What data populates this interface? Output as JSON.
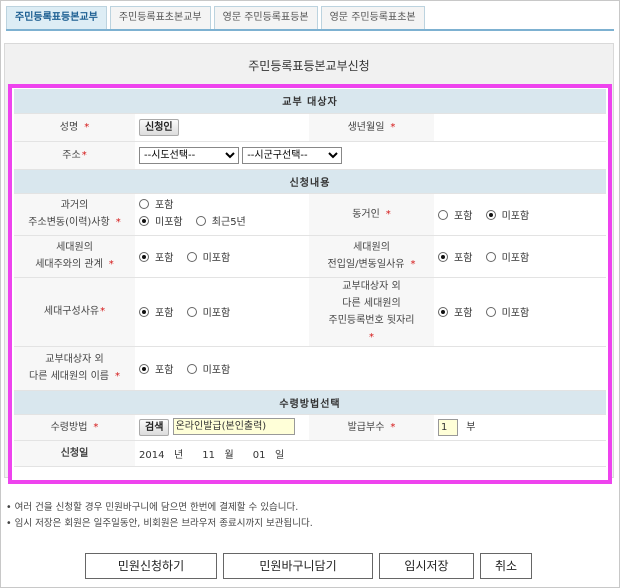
{
  "tabs": [
    {
      "label": "주민등록표등본교부",
      "active": true
    },
    {
      "label": "주민등록표초본교부",
      "active": false
    },
    {
      "label": "영문 주민등록표등본",
      "active": false
    },
    {
      "label": "영문 주민등록표초본",
      "active": false
    }
  ],
  "page_title": "주민등록표등본교부신청",
  "sections": {
    "target": "교부 대상자",
    "content": "신청내용",
    "receive": "수령방법선택"
  },
  "fields": {
    "name_label": "성명",
    "applicant_button": "신청인",
    "birth_label": "생년월일",
    "address_label": "주소",
    "sido_select": "--시도선택--",
    "sigungu_select": "--시군구선택--",
    "history_label": "과거의\n주소변동(이력)사항",
    "cohabitant_label": "동거인",
    "relation_label": "세대원의\n세대주와의 관계",
    "movein_label": "세대원의\n전입일/변동일사유",
    "composition_label": "세대구성사유",
    "other_reg_label": "교부대상자 외\n다른 세대원의\n주민등록번호 뒷자리",
    "other_names_label": "교부대상자 외\n다른 세대원의 이름",
    "method_label": "수령방법",
    "search_button": "검색",
    "method_value": "온라인발급(본인출력)",
    "copies_label": "발급부수",
    "copies_value": "1",
    "copies_unit": "부",
    "date_label": "신청일",
    "date_value": "2014   년      11   월      01   일"
  },
  "options": {
    "include": "포함",
    "exclude": "미포함",
    "recent5": "최근5년"
  },
  "star": "*",
  "notes": [
    "• 여러 건을 신청할 경우 민원바구니에 담으면 한번에 결제할 수 있습니다.",
    "• 임시 저장은 회원은 일주일동안, 비회원은 브라우저 종료시까지 보관됩니다."
  ],
  "buttons": {
    "submit": "민원신청하기",
    "basket": "민원바구니담기",
    "save": "임시저장",
    "cancel": "취소"
  },
  "colors": {
    "highlight": "#ee43ee",
    "section_bg": "#d9e7ee",
    "required_star": "#d41515"
  }
}
